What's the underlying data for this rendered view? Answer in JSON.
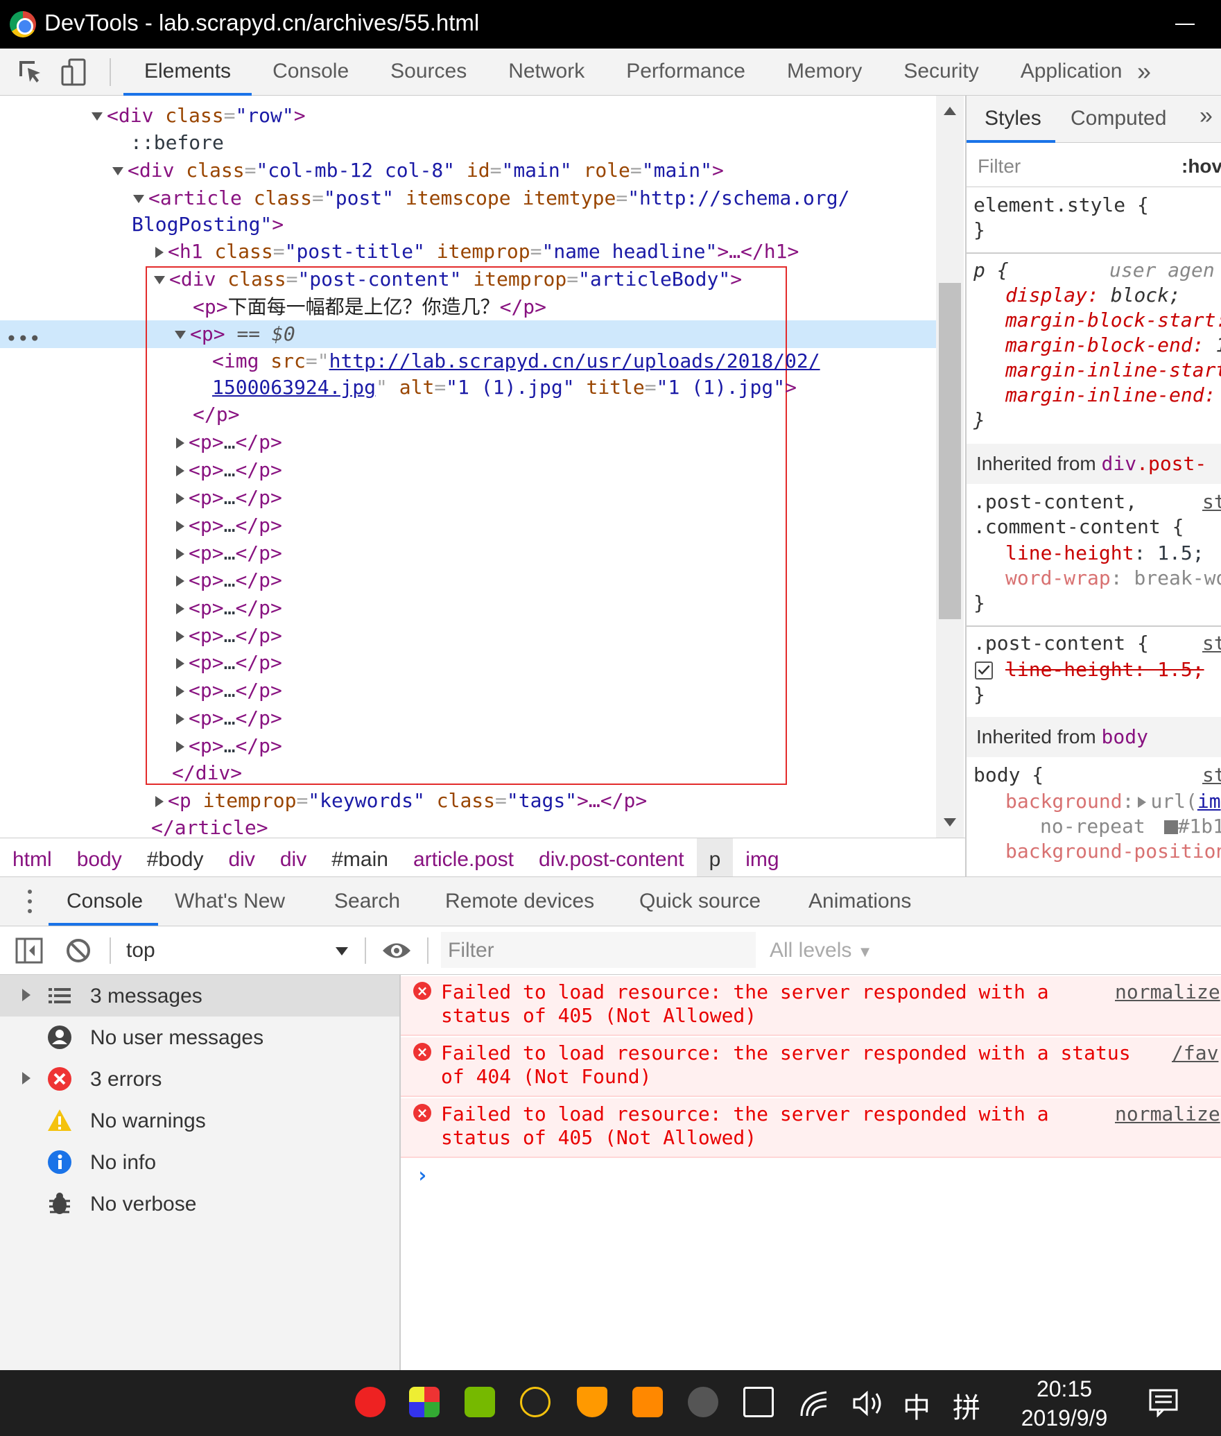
{
  "window": {
    "title": "DevTools - lab.scrapyd.cn/archives/55.html"
  },
  "toolbar": {
    "tabs": [
      "Elements",
      "Console",
      "Sources",
      "Network",
      "Performance",
      "Memory",
      "Security",
      "Application"
    ],
    "overflow": "»"
  },
  "elements": {
    "row_div": {
      "tag_open": "<div",
      "attr": "class",
      "val": "\"row\"",
      "close": ">"
    },
    "before": "::before",
    "main_div": {
      "attr1": "class",
      "val1": "\"col-mb-12 col-8\"",
      "attr2": "id",
      "val2": "\"main\"",
      "attr3": "role",
      "val3": "\"main\""
    },
    "article": {
      "attr1": "class",
      "val1": "\"post\"",
      "attr2": "itemscope",
      "attr3": "itemtype",
      "val3a": "\"http://schema.org/",
      "val3b": "BlogPosting\""
    },
    "h1": {
      "attr1": "class",
      "val1": "\"post-title\"",
      "attr2": "itemprop",
      "val2": "\"name headline\"",
      "tail": ">…</h1>"
    },
    "post_div": {
      "attr1": "class",
      "val1": "\"post-content\"",
      "attr2": "itemprop",
      "val2": "\"articleBody\""
    },
    "p_text": "下面每一幅都是上亿？你造几？",
    "selected_suffix": "== $0",
    "img": {
      "attr_src": "src",
      "src_a": "http://lab.scrapyd.cn/usr/uploads/2018/02/",
      "src_b": "1500063924.jpg",
      "attr_alt": "alt",
      "alt": "\"1 (1).jpg\"",
      "attr_title": "title",
      "title": "\"1 (1).jpg\""
    },
    "collapsed_p": "…",
    "keywords_p": {
      "attr1": "itemprop",
      "val1": "\"keywords\"",
      "attr2": "class",
      "val2": "\"tags\"",
      "tail": ">…</p>"
    },
    "article_close": "</article>",
    "div_close": "</div>",
    "p_close": "</p>"
  },
  "breadcrumbs": [
    "html",
    "body",
    "#body",
    "div",
    "div",
    "#main",
    "article.post",
    "div.post-content",
    "p",
    "img"
  ],
  "styles": {
    "tabs": [
      "Styles",
      "Computed"
    ],
    "overflow": "»",
    "filter_placeholder": "Filter",
    "hov": ":hov",
    "element_style": "element.style {",
    "close_brace": "}",
    "p_rule": {
      "selector": "p {",
      "origin": "user agen",
      "props": [
        "display",
        "margin-block-start",
        "margin-block-end",
        "margin-inline-start",
        "margin-inline-end"
      ],
      "display_val": "block;",
      "end_val": "1"
    },
    "inherited_post": {
      "label": "Inherited from",
      "selector_tag": "div",
      "selector_class": ".post-"
    },
    "pc_rule": {
      "sel1": ".post-content,",
      "sel2": ".comment-content {",
      "src": "st",
      "prop1": "line-height",
      "val1": "1.5;",
      "prop2": "word-wrap",
      "val2": "break-wo"
    },
    "pc_rule2": {
      "sel": ".post-content {",
      "src": "st",
      "prop": "line-height: 1.5;"
    },
    "inherited_body": {
      "label": "Inherited from",
      "selector": "body"
    },
    "body_rule": {
      "sel": "body {",
      "src": "st",
      "prop1": "background",
      "val1": "url(",
      "val1_link": "im",
      "val2": "no-repeat",
      "val3": "#1b1",
      "prop2": "background-position"
    }
  },
  "drawer": {
    "tabs": [
      "Console",
      "What's New",
      "Search",
      "Remote devices",
      "Quick source",
      "Animations"
    ]
  },
  "console_toolbar": {
    "context": "top",
    "filter_placeholder": "Filter",
    "levels": "All levels"
  },
  "sidebar": [
    {
      "label": "3 messages",
      "icon": "list-icon"
    },
    {
      "label": "No user messages",
      "icon": "user-icon"
    },
    {
      "label": "3 errors",
      "icon": "error-icon"
    },
    {
      "label": "No warnings",
      "icon": "warning-icon"
    },
    {
      "label": "No info",
      "icon": "info-icon"
    },
    {
      "label": "No verbose",
      "icon": "bug-icon"
    }
  ],
  "messages": [
    {
      "text": "Failed to load resource: the server responded with a status of 405 (Not Allowed)",
      "source": "normalize"
    },
    {
      "text": "Failed to load resource: the server responded with a status of 404 (Not Found)",
      "source": "/fav"
    },
    {
      "text": "Failed to load resource: the server responded with a status of 405 (Not Allowed)",
      "source": "normalize"
    }
  ],
  "prompt": "›",
  "taskbar": {
    "time": "20:15",
    "date": "2019/9/9",
    "ime1": "中",
    "ime2": "拼"
  },
  "colors": {
    "accent": "#1a73e8",
    "error": "#e80000",
    "tag": "#881280",
    "attr": "#994500",
    "value": "#1a1aa6"
  }
}
